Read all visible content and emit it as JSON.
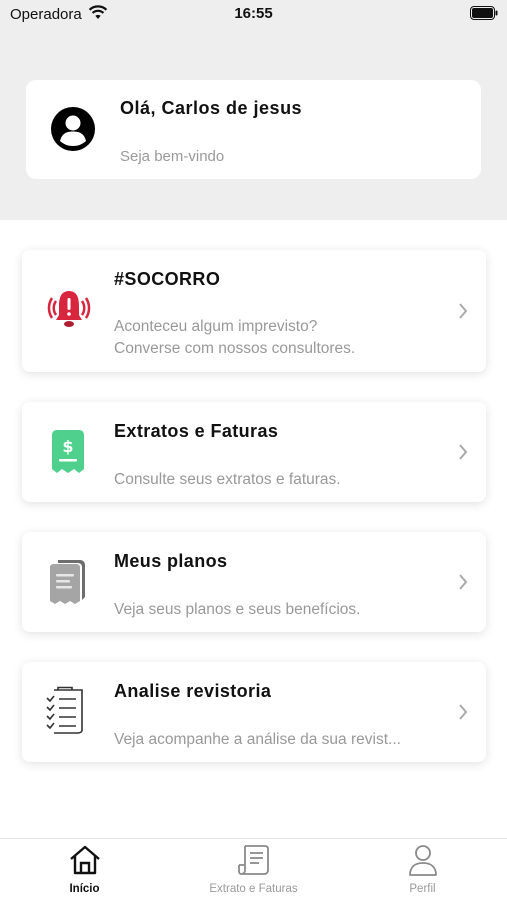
{
  "status_bar": {
    "carrier": "Operadora",
    "time": "16:55"
  },
  "greeting": {
    "name": "Olá, Carlos de jesus",
    "subtitle": "Seja bem-vindo"
  },
  "menu": [
    {
      "title": "#SOCORRO",
      "description": "Aconteceu algum imprevisto?\nConverse com nossos consultores.",
      "icon": "alarm-bell-icon",
      "color": "#d7263d"
    },
    {
      "title": "Extratos e Faturas",
      "description": "Consulte seus extratos e faturas.",
      "icon": "receipt-dollar-icon",
      "color": "#4fd08c"
    },
    {
      "title": "Meus planos",
      "description": "Veja seus planos e seus benefícios.",
      "icon": "documents-icon",
      "color": "#8f8f8f"
    },
    {
      "title": "Analise revistoria",
      "description": "Veja acompanhe a análise da sua revist...",
      "icon": "checklist-icon",
      "color": "#333333"
    }
  ],
  "tabs": [
    {
      "label": "Início",
      "icon": "home-icon",
      "active": true
    },
    {
      "label": "Extrato e Faturas",
      "icon": "statement-icon",
      "active": false
    },
    {
      "label": "Perfil",
      "icon": "person-icon",
      "active": false
    }
  ]
}
